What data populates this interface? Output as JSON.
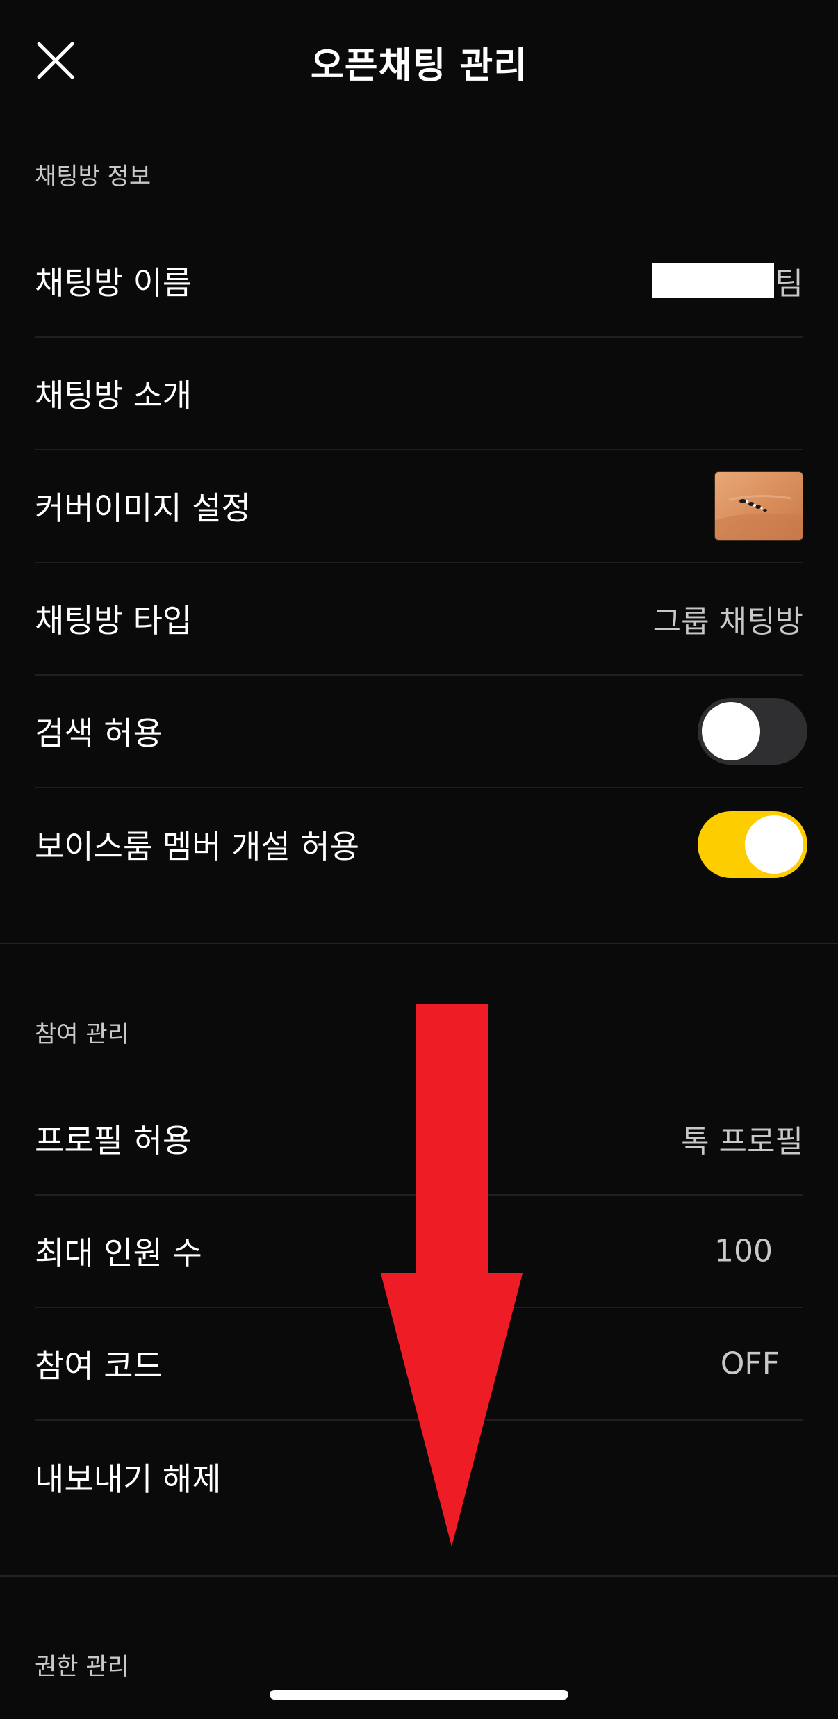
{
  "header": {
    "title": "오픈채팅 관리"
  },
  "room_info": {
    "section_title": "채팅방 정보",
    "name_label": "채팅방 이름",
    "name_suffix": "팀",
    "intro_label": "채팅방 소개",
    "cover_label": "커버이미지 설정",
    "type_label": "채팅방 타입",
    "type_value": "그룹 채팅방",
    "search_label": "검색 허용",
    "search_enabled": false,
    "voiceroom_label": "보이스룸 멤버 개설 허용",
    "voiceroom_enabled": true
  },
  "participation": {
    "section_title": "참여 관리",
    "profile_label": "프로필 허용",
    "profile_value": "톡 프로필",
    "max_label": "최대 인원 수",
    "max_value": "100",
    "code_label": "참여 코드",
    "code_value": "OFF",
    "export_label": "내보내기 해제"
  },
  "permissions": {
    "section_title": "권한 관리"
  },
  "colors": {
    "background": "#0a0a0a",
    "toggle_on": "#fecd00",
    "toggle_off": "#2f2f31",
    "annotation_arrow": "#ee1c25"
  }
}
